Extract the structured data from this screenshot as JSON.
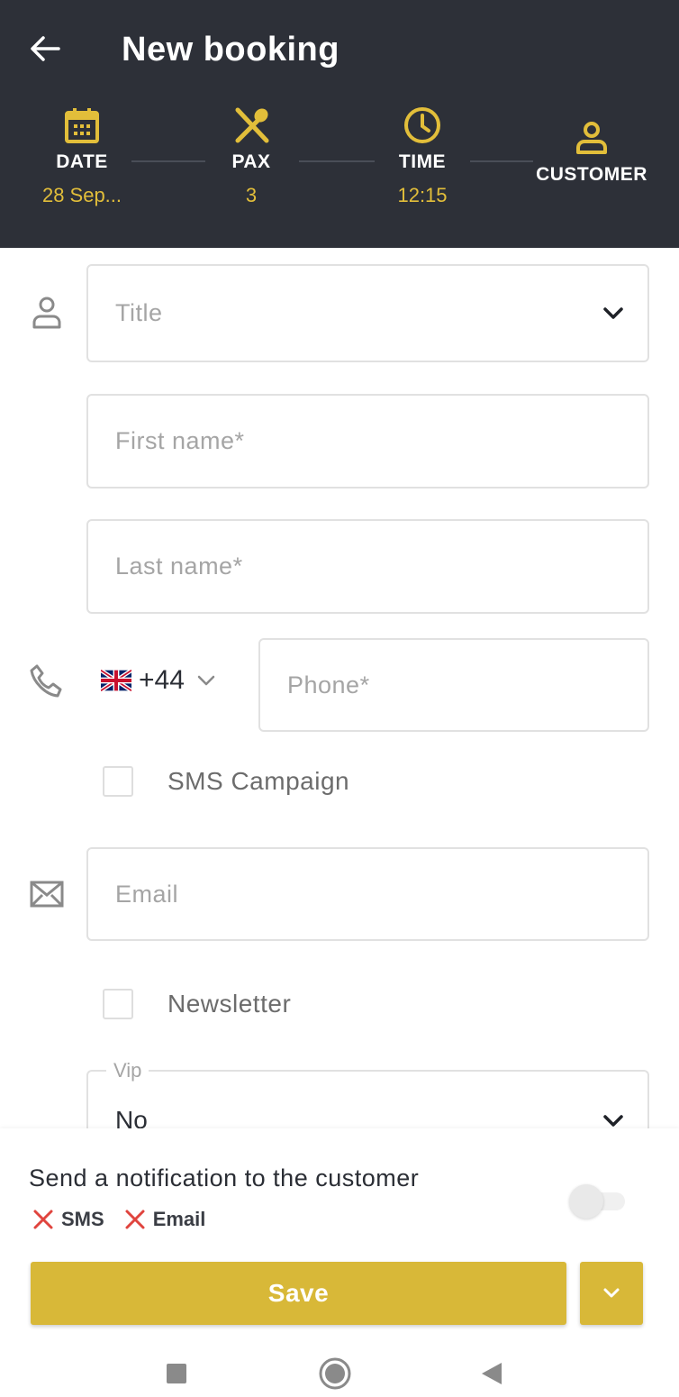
{
  "header": {
    "title": "New booking",
    "steps": [
      {
        "label": "DATE",
        "value": "28 Sep...",
        "icon": "calendar-icon"
      },
      {
        "label": "PAX",
        "value": "3",
        "icon": "fork-spoon-icon"
      },
      {
        "label": "TIME",
        "value": "12:15",
        "icon": "clock-icon"
      },
      {
        "label": "CUSTOMER",
        "value": "",
        "icon": "person-icon"
      }
    ]
  },
  "form": {
    "title_placeholder": "Title",
    "first_name_placeholder": "First name*",
    "last_name_placeholder": "Last name*",
    "country_code": "+44",
    "country_flag": "uk-flag-icon",
    "phone_placeholder": "Phone*",
    "sms_campaign_label": "SMS Campaign",
    "email_placeholder": "Email",
    "newsletter_label": "Newsletter",
    "vip_label": "Vip",
    "vip_value": "No"
  },
  "footer": {
    "notification_label": "Send a notification to the customer",
    "channels": [
      "SMS",
      "Email"
    ],
    "save_label": "Save"
  },
  "colors": {
    "header_bg": "#2d3038",
    "accent": "#e2be3a",
    "save_bg": "#d8b838",
    "channel_off": "#e0443e"
  }
}
